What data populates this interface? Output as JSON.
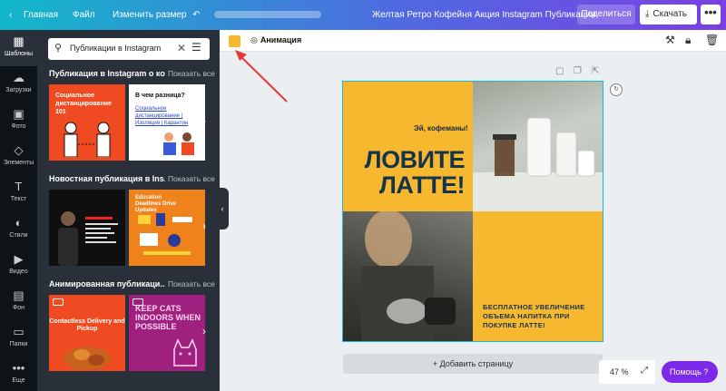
{
  "topbar": {
    "back_icon": "chevron-left-icon",
    "home": "Главная",
    "file": "Файл",
    "resize": "Изменить размер",
    "undo_icon": "undo-icon",
    "title": "Желтая Ретро Кофейня Акция Instagram Публикация",
    "share": "Поделиться",
    "download": "Скачать",
    "more": "•••"
  },
  "rail": {
    "items": [
      {
        "label": "Шаблоны",
        "icon": "templates-icon",
        "glyph": "▦"
      },
      {
        "label": "Загрузки",
        "icon": "upload-icon",
        "glyph": "☁"
      },
      {
        "label": "Фото",
        "icon": "photo-icon",
        "glyph": "▣"
      },
      {
        "label": "Элементы",
        "icon": "elements-icon",
        "glyph": "◇"
      },
      {
        "label": "Текст",
        "icon": "text-icon",
        "glyph": "T"
      },
      {
        "label": "Стили",
        "icon": "palette-icon",
        "glyph": "◐"
      },
      {
        "label": "Видео",
        "icon": "video-icon",
        "glyph": "▶"
      },
      {
        "label": "Фон",
        "icon": "background-icon",
        "glyph": "▤"
      },
      {
        "label": "Папки",
        "icon": "folder-icon",
        "glyph": "▭"
      },
      {
        "label": "Еще",
        "icon": "more-icon",
        "glyph": "•••"
      }
    ]
  },
  "panel": {
    "search_value": "Публикации в Instagram",
    "show_all": "Показать все",
    "sections": [
      {
        "title": "Публикация в Instagram о ко..."
      },
      {
        "title": "Новостная публикация в Ins..."
      },
      {
        "title": "Анимированная публикаци..."
      }
    ],
    "thumbs": {
      "t1": "Социальное дистанцирование 101",
      "t2_title": "В чем разница?",
      "t2_words": "Социальное дистанцирование | Изоляция | Карантин",
      "t4": "Education Deadlines Drive Updates",
      "t5": "Contactless Delivery and Pickup",
      "t6": "KEEP CATS INDOORS WHEN POSSIBLE"
    }
  },
  "canvas_toolbar": {
    "color": "#f5b82e",
    "animation": "Анимация"
  },
  "design": {
    "greeting": "Эй, кофеманы!",
    "headline": "ЛОВИТЕ ЛАТТЕ!",
    "promo": "БЕСПЛАТНОЕ УВЕЛИЧЕНИЕ ОБЪЕМА НАПИТКА ПРИ ПОКУПКЕ ЛАТТЕ!",
    "accent": "#f5b82e",
    "text_color": "#17324b"
  },
  "add_page": "+ Добавить страницу",
  "zoom": "47 %",
  "help": "Помощь ?"
}
